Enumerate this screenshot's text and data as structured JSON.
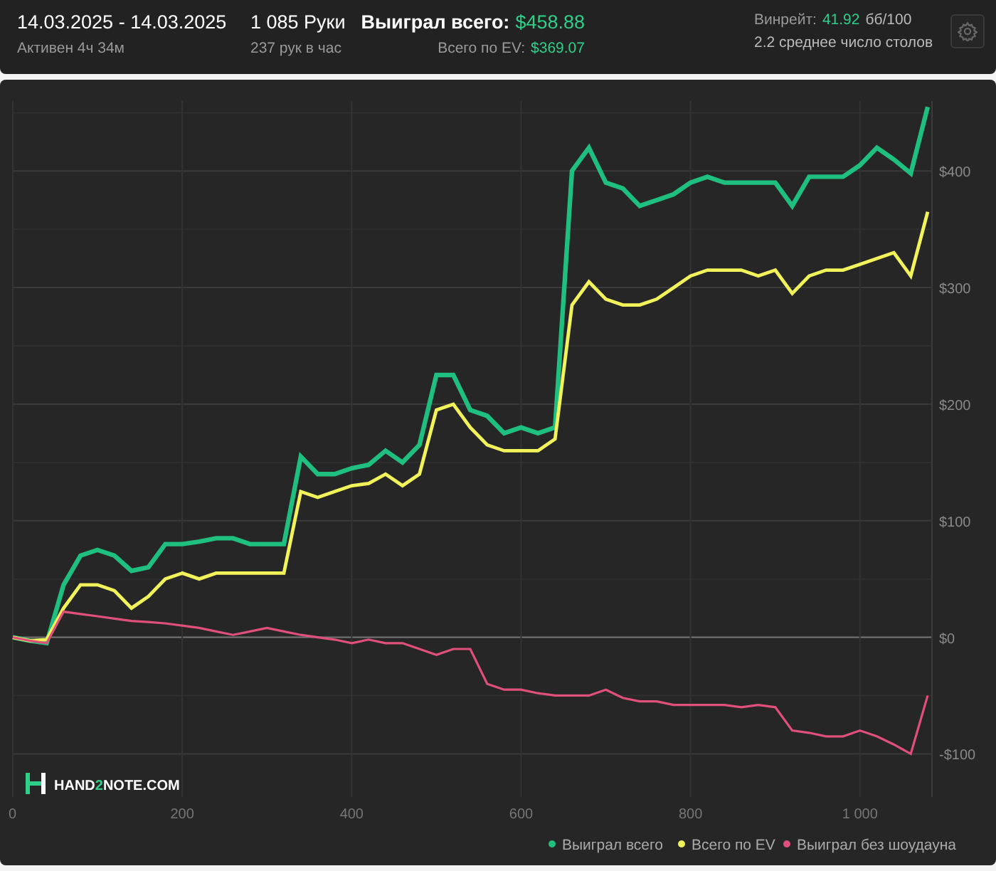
{
  "header": {
    "date_range": "14.03.2025 - 14.03.2025",
    "active": "Активен 4ч 34м",
    "hands": "1 085 Руки",
    "hands_per_hour": "237 рук в час",
    "won_label": "Выиграл всего:",
    "won_value": "$458.88",
    "ev_label": "Всего по EV:",
    "ev_value": "$369.07",
    "winrate_label": "Винрейт:",
    "winrate_value": "41.92",
    "winrate_unit": "бб/100",
    "tables": "2.2 среднее число столов"
  },
  "logo": {
    "before": "HAND",
    "accent": "2",
    "after": "NOTE.COM"
  },
  "chart_data": {
    "type": "line",
    "grid": true,
    "legend": true,
    "xlim": [
      0,
      1085
    ],
    "ylim": [
      -137,
      460
    ],
    "xticks": [
      {
        "value": 0,
        "label": "0"
      },
      {
        "value": 200,
        "label": "200"
      },
      {
        "value": 400,
        "label": "400"
      },
      {
        "value": 600,
        "label": "600"
      },
      {
        "value": 800,
        "label": "800"
      },
      {
        "value": 1000,
        "label": "1 000"
      }
    ],
    "yticks": [
      {
        "value": -100,
        "label": "-$100"
      },
      {
        "value": 0,
        "label": "$0"
      },
      {
        "value": 100,
        "label": "$100"
      },
      {
        "value": 200,
        "label": "$200"
      },
      {
        "value": 300,
        "label": "$300"
      },
      {
        "value": 400,
        "label": "$400"
      }
    ],
    "x": [
      0,
      20,
      40,
      60,
      80,
      100,
      120,
      140,
      160,
      180,
      200,
      220,
      240,
      260,
      280,
      300,
      320,
      340,
      360,
      380,
      400,
      420,
      440,
      460,
      480,
      500,
      520,
      540,
      560,
      580,
      600,
      620,
      640,
      660,
      680,
      700,
      720,
      740,
      760,
      780,
      800,
      820,
      840,
      860,
      880,
      900,
      920,
      940,
      960,
      980,
      1000,
      1020,
      1040,
      1060,
      1080
    ],
    "series": [
      {
        "name": "Выиграл всего",
        "color": "#1fbf7f",
        "values": [
          0,
          -3,
          -5,
          45,
          70,
          75,
          70,
          57,
          60,
          80,
          80,
          82,
          85,
          85,
          80,
          80,
          80,
          155,
          140,
          140,
          145,
          148,
          160,
          150,
          165,
          225,
          225,
          195,
          190,
          175,
          180,
          175,
          180,
          400,
          420,
          390,
          385,
          370,
          375,
          380,
          390,
          395,
          390,
          390,
          390,
          390,
          370,
          395,
          395,
          395,
          405,
          420,
          410,
          398,
          455
        ]
      },
      {
        "name": "Всего по EV",
        "color": "#f2f25a",
        "values": [
          0,
          -3,
          -2,
          25,
          45,
          45,
          40,
          25,
          35,
          50,
          55,
          50,
          55,
          55,
          55,
          55,
          55,
          125,
          120,
          125,
          130,
          132,
          140,
          130,
          140,
          195,
          200,
          180,
          165,
          160,
          160,
          160,
          170,
          285,
          305,
          290,
          285,
          285,
          290,
          300,
          310,
          315,
          315,
          315,
          310,
          315,
          295,
          310,
          315,
          315,
          320,
          325,
          330,
          310,
          365
        ]
      },
      {
        "name": "Выиграл без шоудауна",
        "color": "#e0507a",
        "values": [
          0,
          -3,
          -5,
          22,
          20,
          18,
          16,
          14,
          13,
          12,
          10,
          8,
          5,
          2,
          5,
          8,
          5,
          2,
          0,
          -2,
          -5,
          -2,
          -5,
          -5,
          -10,
          -15,
          -10,
          -10,
          -40,
          -45,
          -45,
          -48,
          -50,
          -50,
          -50,
          -45,
          -52,
          -55,
          -55,
          -58,
          -58,
          -58,
          -58,
          -60,
          -58,
          -60,
          -80,
          -82,
          -85,
          -85,
          -80,
          -85,
          -92,
          -100,
          -50
        ]
      }
    ]
  }
}
